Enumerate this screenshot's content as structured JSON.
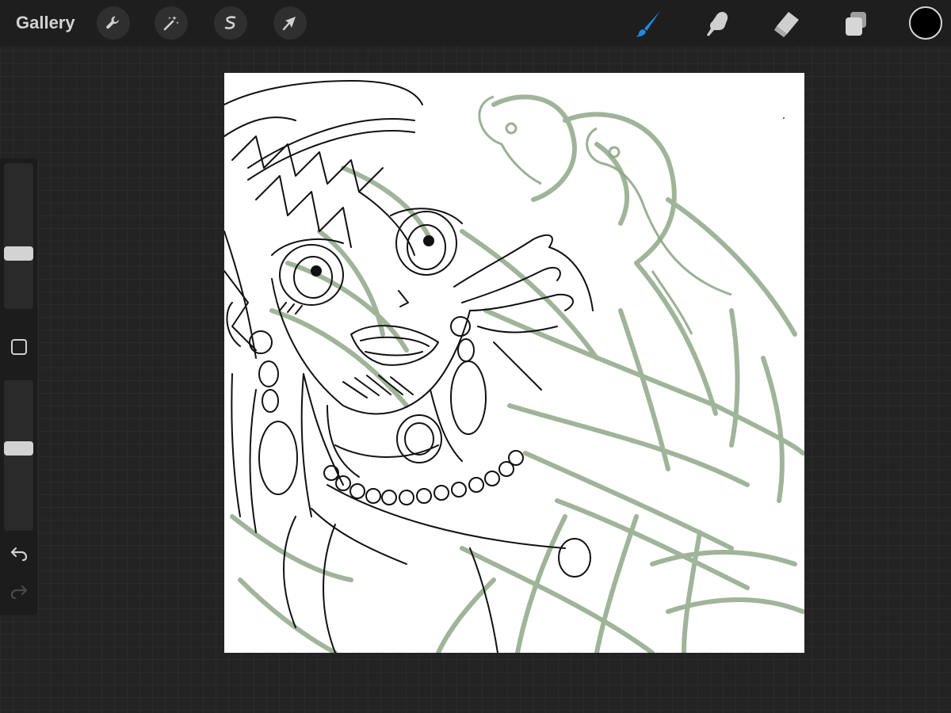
{
  "toolbar": {
    "gallery_label": "Gallery",
    "left_tools": [
      {
        "name": "actions",
        "icon": "wrench-icon"
      },
      {
        "name": "adjustments",
        "icon": "magic-wand-icon"
      },
      {
        "name": "selection",
        "icon": "selection-s-icon"
      },
      {
        "name": "transform",
        "icon": "arrow-cursor-icon"
      }
    ],
    "right_tools": [
      {
        "name": "brush",
        "icon": "brush-icon",
        "active": true
      },
      {
        "name": "smudge",
        "icon": "smudge-finger-icon",
        "active": false
      },
      {
        "name": "eraser",
        "icon": "eraser-icon",
        "active": false
      },
      {
        "name": "layers",
        "icon": "layers-icon",
        "active": false
      }
    ],
    "current_color": "#000000"
  },
  "sidebar": {
    "brush_size_level": 0.37,
    "opacity_level": 0.55,
    "modify_icon": "square-icon",
    "undo_icon": "undo-icon",
    "redo_icon": "redo-icon"
  },
  "colors": {
    "accent": "#1e88e5",
    "sketch_green": "#8fa888",
    "ink": "#111111",
    "canvas": "#ffffff"
  }
}
